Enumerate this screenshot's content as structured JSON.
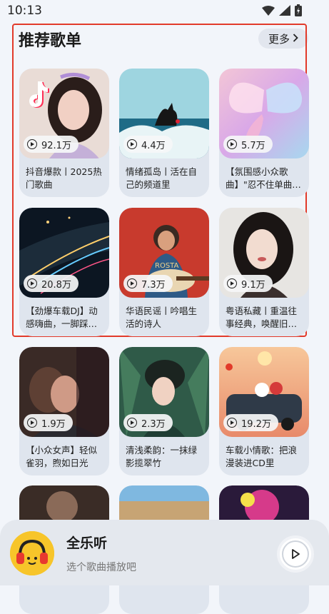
{
  "status_bar": {
    "time": "10:13"
  },
  "section": {
    "title": "推荐歌单",
    "more_label": "更多"
  },
  "playlists": [
    {
      "plays": "92.1万",
      "title": "抖音爆款丨2025热门歌曲"
    },
    {
      "plays": "4.4万",
      "title": "情绪孤岛丨活在自己的频道里"
    },
    {
      "plays": "5.7万",
      "title": "【氛围感小众歌曲】\"忍不住单曲…"
    },
    {
      "plays": "20.8万",
      "title": "【劲爆车载DJ】动感嗨曲，一脚踩…"
    },
    {
      "plays": "7.3万",
      "title": "华语民谣丨吟唱生活的诗人"
    },
    {
      "plays": "9.1万",
      "title": "粤语私藏丨重温往事经典，唤醒旧…"
    },
    {
      "plays": "1.9万",
      "title": "【小众女声】轻似雀羽，煦如日光"
    },
    {
      "plays": "2.3万",
      "title": "清浅柔韵：一抹绿影揽翠竹"
    },
    {
      "plays": "19.2万",
      "title": "车载小情歌：把浪漫装进CD里"
    }
  ],
  "player": {
    "title": "全乐听",
    "subtitle": "选个歌曲播放吧"
  }
}
